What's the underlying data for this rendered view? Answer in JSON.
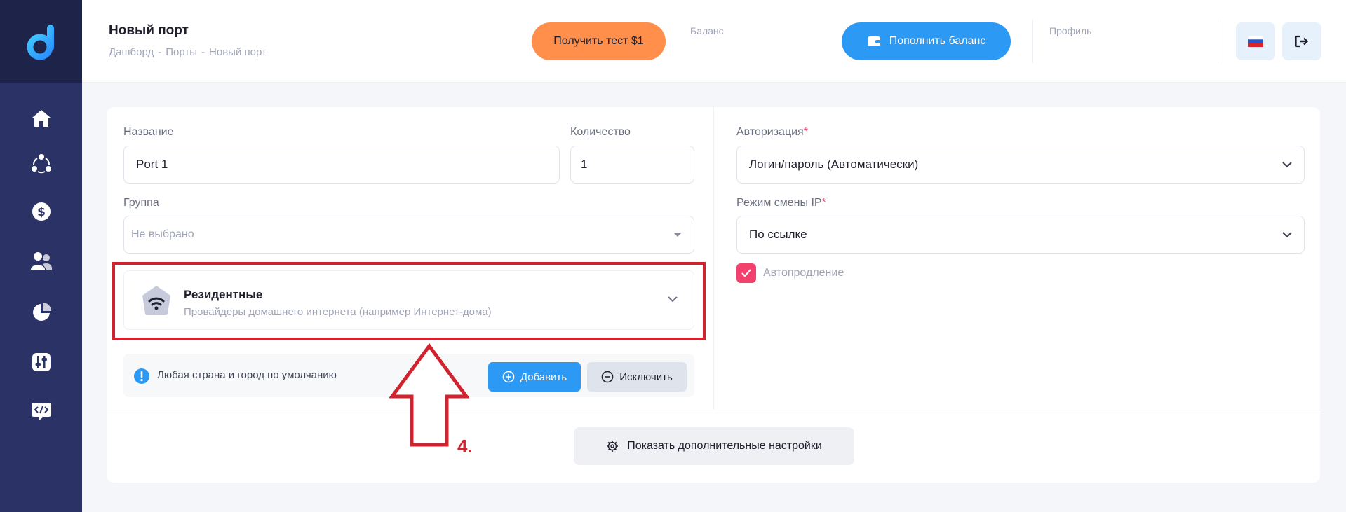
{
  "header": {
    "title": "Новый порт",
    "breadcrumb": [
      "Дашборд",
      "-",
      "Порты",
      "-",
      "Новый порт"
    ],
    "test_button": "Получить тест $1",
    "balance_label": "Баланс",
    "topup_button": "Пополнить баланс",
    "profile_label": "Профиль",
    "language": "ru-flag-icon",
    "logout": "logout-icon"
  },
  "sidebar": {
    "logo": "d-logo-icon",
    "items": [
      "home-icon",
      "network-icon",
      "dollar-icon",
      "users-icon",
      "pie-chart-icon",
      "sliders-icon",
      "api-code-icon"
    ]
  },
  "form": {
    "name": {
      "label": "Название",
      "value": "Port 1"
    },
    "quantity": {
      "label": "Количество",
      "value": "1"
    },
    "group": {
      "label": "Группа",
      "placeholder": "Не выбрано"
    },
    "proxy_type": {
      "title": "Резидентные",
      "subtitle": "Провайдеры домашнего интернета (например Интернет-дома)"
    },
    "geo": {
      "text": "Любая страна и город по умолчанию",
      "add_button": "Добавить",
      "exclude_button": "Исключить"
    },
    "authorization": {
      "label": "Авторизация",
      "required_mark": "*",
      "value": "Логин/пароль (Автоматически)"
    },
    "ip_change": {
      "label": "Режим смены IP",
      "required_mark": "*",
      "value": "По ссылке"
    },
    "autorenew": {
      "label": "Автопродление",
      "checked": true
    },
    "more_settings_button": "Показать дополнительные настройки"
  },
  "annotation": {
    "step": "4."
  },
  "colors": {
    "sidebar": "#2b3266",
    "accent_orange": "#ff8f4a",
    "accent_blue": "#2c9af5",
    "accent_red": "#f1416c",
    "annotation_red": "#d0222f"
  }
}
